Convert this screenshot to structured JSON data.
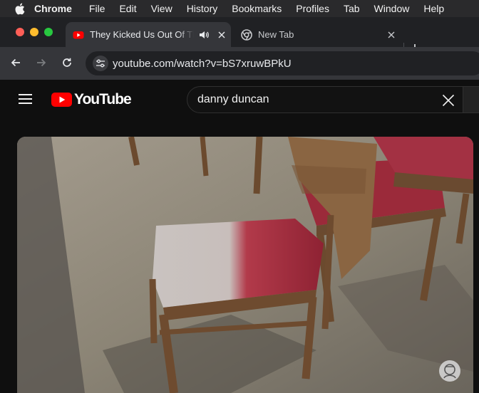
{
  "menubar": {
    "app": "Chrome",
    "items": [
      "File",
      "Edit",
      "View",
      "History",
      "Bookmarks",
      "Profiles",
      "Tab",
      "Window",
      "Help"
    ]
  },
  "tabs": [
    {
      "title": "They Kicked Us Out Of Th",
      "favicon": "youtube-icon",
      "audio": true,
      "active": true
    },
    {
      "title": "New Tab",
      "favicon": "chrome-icon",
      "audio": false,
      "active": false
    }
  ],
  "toolbar": {
    "url": "youtube.com/watch?v=bS7xruwBPkU"
  },
  "youtube": {
    "logo_text": "YouTube",
    "search_value": "danny duncan"
  },
  "colors": {
    "youtube_red": "#ff0000",
    "page_bg": "#0f0f0f",
    "chrome_toolbar": "#35363a"
  }
}
